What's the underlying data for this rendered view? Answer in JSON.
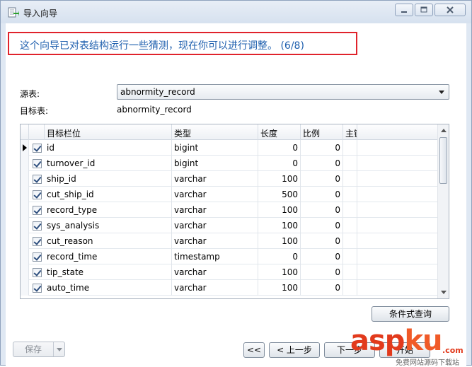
{
  "window": {
    "title": "导入向导",
    "controls": [
      "minimize",
      "maximize",
      "close"
    ]
  },
  "banner": {
    "text": "这个向导已对表结构运行一些猜测，现在你可以进行调整。 (6/8)"
  },
  "source": {
    "label": "源表:",
    "value": "abnormity_record"
  },
  "target": {
    "label": "目标表:",
    "value": "abnormity_record"
  },
  "grid": {
    "columns": [
      "目标栏位",
      "类型",
      "长度",
      "比例",
      "主键"
    ],
    "rows": [
      {
        "name": "id",
        "type": "bigint",
        "length": "0",
        "scale": "0"
      },
      {
        "name": "turnover_id",
        "type": "bigint",
        "length": "0",
        "scale": "0"
      },
      {
        "name": "ship_id",
        "type": "varchar",
        "length": "100",
        "scale": "0"
      },
      {
        "name": "cut_ship_id",
        "type": "varchar",
        "length": "500",
        "scale": "0"
      },
      {
        "name": "record_type",
        "type": "varchar",
        "length": "100",
        "scale": "0"
      },
      {
        "name": "sys_analysis",
        "type": "varchar",
        "length": "100",
        "scale": "0"
      },
      {
        "name": "cut_reason",
        "type": "varchar",
        "length": "100",
        "scale": "0"
      },
      {
        "name": "record_time",
        "type": "timestamp",
        "length": "0",
        "scale": "0"
      },
      {
        "name": "tip_state",
        "type": "varchar",
        "length": "100",
        "scale": "0"
      },
      {
        "name": "auto_time",
        "type": "varchar",
        "length": "100",
        "scale": "0"
      }
    ]
  },
  "buttons": {
    "conditional_query": "条件式查询",
    "save": "保存",
    "first": "<<",
    "prev": "< 上一步",
    "next": "下一步",
    "finish": "开始"
  },
  "watermark": {
    "main_asp": "asp",
    "main_ku": "ku",
    "com": ".com",
    "sub": "免费网站源码下载站"
  },
  "colors": {
    "banner_border": "#e0232b",
    "banner_text": "#1e5fae",
    "watermark": "#e23a1c"
  }
}
